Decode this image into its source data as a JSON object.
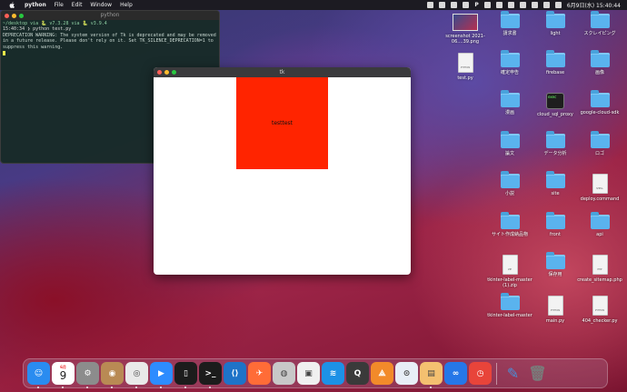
{
  "menubar": {
    "app_name": "python",
    "items": [
      "File",
      "Edit",
      "Window",
      "Help"
    ],
    "clock": "6月9日(水) 15:40:44",
    "status_letter": "P"
  },
  "terminal": {
    "title": "python",
    "prompt": "~/desktop via 🐍 v7.3.28 via 🐍 v3.9.4",
    "cmd_line": "15:40:34 ❯ python test.py",
    "warning": "DEPRECATION WARNING: The system version of Tk is deprecated and may be removed in a future release. Please don't rely on it. Set TK_SILENCE_DEPRECATION=1 to suppress this warning."
  },
  "tk_window": {
    "title": "tk",
    "label_text": "testtest",
    "label_bg": "#ff2400"
  },
  "desktop": {
    "icons": [
      {
        "label": "screenshot 2021-06....39.png",
        "type": "image"
      },
      {
        "label": "請求書",
        "type": "folder"
      },
      {
        "label": "light",
        "type": "folder"
      },
      {
        "label": "スクレイピング",
        "type": "folder"
      },
      {
        "label": "test.py",
        "type": "doc",
        "tag": "PYTHON"
      },
      {
        "label": "確定申告",
        "type": "folder"
      },
      {
        "label": "firebase",
        "type": "folder"
      },
      {
        "label": "画像",
        "type": "folder"
      },
      {
        "label": "漫画",
        "type": "folder"
      },
      {
        "label": "cloud_sql_proxy",
        "type": "terminal",
        "tag": "exec"
      },
      {
        "label": "google-cloud-sdk",
        "type": "folder"
      },
      {
        "label": "論文",
        "type": "folder"
      },
      {
        "label": "データ分析",
        "type": "folder"
      },
      {
        "label": "ロゴ",
        "type": "folder"
      },
      {
        "label": "小説",
        "type": "folder"
      },
      {
        "label": "site",
        "type": "folder"
      },
      {
        "label": "deploy.command",
        "type": "doc",
        "tag": "SHELL"
      },
      {
        "label": "サイト作成納品物",
        "type": "folder"
      },
      {
        "label": "front",
        "type": "folder"
      },
      {
        "label": "api",
        "type": "folder"
      },
      {
        "label": "tkinter-label-master (1).zip",
        "type": "doc",
        "tag": "ZIP"
      },
      {
        "label": "保存用",
        "type": "folder"
      },
      {
        "label": "create_sitemap.php",
        "type": "doc",
        "tag": "PHP"
      },
      {
        "label": "tkinter-label-master",
        "type": "folder"
      },
      {
        "label": "main.py",
        "type": "doc",
        "tag": "PYTHON"
      },
      {
        "label": "404_checker.py",
        "type": "doc",
        "tag": "PYTHON"
      }
    ]
  },
  "dock": {
    "calendar_day": "9",
    "calendar_month": "6月",
    "apps": [
      {
        "name": "finder",
        "glyph": "☺",
        "color": "#2a8cf0"
      },
      {
        "name": "calendar",
        "glyph": "",
        "color": "#ffffff"
      },
      {
        "name": "system-preferences",
        "glyph": "⚙",
        "color": "#8c8c8c"
      },
      {
        "name": "contacts",
        "glyph": "◉",
        "color": "#b98a54"
      },
      {
        "name": "chrome",
        "glyph": "◎",
        "color": "#e9e9e9"
      },
      {
        "name": "zoom",
        "glyph": "▶",
        "color": "#2d8cff"
      },
      {
        "name": "terminal-a",
        "glyph": "▯",
        "color": "#1c1c1c"
      },
      {
        "name": "terminal-b",
        "glyph": ">_",
        "color": "#1c1c1c"
      },
      {
        "name": "vscode",
        "glyph": "⟨⟩",
        "color": "#1e73c8"
      },
      {
        "name": "postman",
        "glyph": "✈",
        "color": "#ff6c37"
      },
      {
        "name": "sequel",
        "glyph": "◍",
        "color": "#c8c8c8"
      },
      {
        "name": "docker-toolbox",
        "glyph": "▣",
        "color": "#f0f0f0"
      },
      {
        "name": "docker",
        "glyph": "≋",
        "color": "#1d91e6"
      },
      {
        "name": "quicktime",
        "glyph": "Q",
        "color": "#3a3a3a"
      },
      {
        "name": "sourcetree",
        "glyph": "⟁",
        "color": "#f28a2a"
      },
      {
        "name": "app-store-like",
        "glyph": "⊙",
        "color": "#e8eef7"
      },
      {
        "name": "preview",
        "glyph": "▤",
        "color": "#f4c070"
      },
      {
        "name": "infinity",
        "glyph": "∞",
        "color": "#2677e8"
      },
      {
        "name": "clock",
        "glyph": "◷",
        "color": "#e8443a"
      }
    ],
    "extra": [
      {
        "name": "feather",
        "glyph": "✎",
        "color": "#4a8fd8"
      },
      {
        "name": "trash",
        "glyph": "🗑",
        "color": "#7a7a7a"
      }
    ]
  }
}
